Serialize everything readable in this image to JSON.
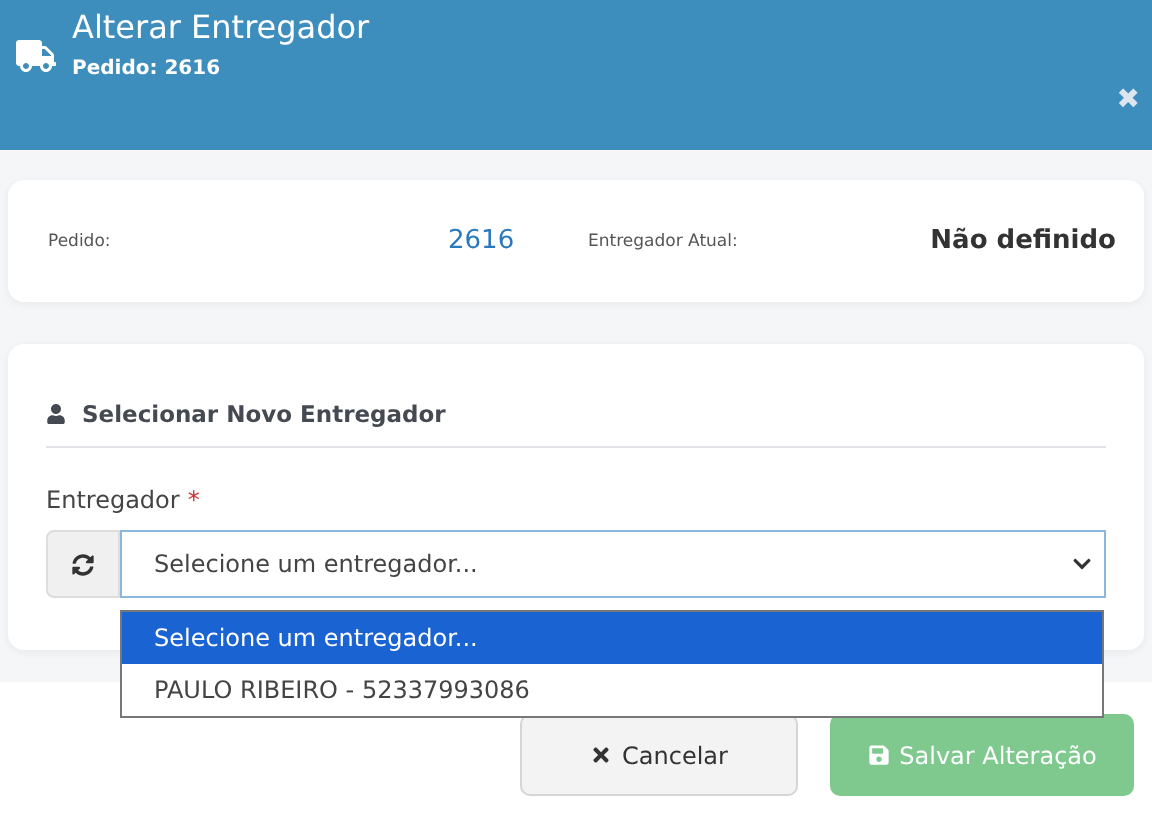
{
  "header": {
    "title": "Alterar Entregador",
    "subtitle_label": "Pedido:",
    "subtitle_value": "2616",
    "close": "✖"
  },
  "summary": {
    "order_label": "Pedido:",
    "order_value": "2616",
    "courier_label": "Entregador Atual:",
    "courier_value": "Não definido"
  },
  "section": {
    "title": "Selecionar Novo Entregador",
    "field_label": "Entregador",
    "required": "*",
    "value": "Selecione um entregador...",
    "expanded": true,
    "options": [
      {
        "label": "Selecione um entregador...",
        "selected": true
      },
      {
        "label": "PAULO RIBEIRO - 52337993086",
        "selected": false
      }
    ]
  },
  "buttons": [
    {
      "label": "Cancelar",
      "kind": "cancel",
      "disabled": false
    },
    {
      "label": "Salvar Alteração",
      "kind": "save",
      "disabled": true
    }
  ]
}
